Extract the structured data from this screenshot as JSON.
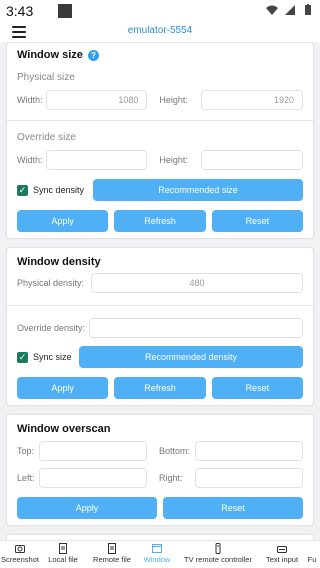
{
  "status": {
    "time": "3:43"
  },
  "toolbar": {
    "title": "emulator-5554"
  },
  "window_size": {
    "title": "Window size",
    "physical_label": "Physical size",
    "width_label": "Width:",
    "width_value": "1080",
    "height_label": "Height:",
    "height_value": "1920",
    "override_label": "Override size",
    "override_width_label": "Width:",
    "override_width_value": "",
    "override_height_label": "Height:",
    "override_height_value": "",
    "sync_label": "Sync density",
    "recommended_label": "Recommended size",
    "apply_label": "Apply",
    "refresh_label": "Refresh",
    "reset_label": "Reset"
  },
  "window_density": {
    "title": "Window density",
    "physical_label": "Physical density:",
    "physical_value": "480",
    "override_label": "Override density:",
    "override_value": "",
    "sync_label": "Sync size",
    "recommended_label": "Recommended density",
    "apply_label": "Apply",
    "refresh_label": "Refresh",
    "reset_label": "Reset"
  },
  "window_overscan": {
    "title": "Window overscan",
    "top_label": "Top:",
    "bottom_label": "Bottom:",
    "left_label": "Left:",
    "right_label": "Right:",
    "apply_label": "Apply",
    "reset_label": "Reset"
  },
  "bottom_nav": {
    "items": [
      {
        "label": "Screenshot",
        "icon": "camera-icon"
      },
      {
        "label": "Local file",
        "icon": "file-icon"
      },
      {
        "label": "Remote file",
        "icon": "file-icon"
      },
      {
        "label": "Window",
        "icon": "window-icon",
        "active": true
      },
      {
        "label": "TV remote controller",
        "icon": "remote-icon"
      },
      {
        "label": "Text input",
        "icon": "keyboard-icon"
      },
      {
        "label": "Fu",
        "icon": ""
      }
    ]
  },
  "colors": {
    "accent": "#4fb0f5",
    "title_blue": "#2b8fd8",
    "checkbox": "#1e7a5e"
  }
}
